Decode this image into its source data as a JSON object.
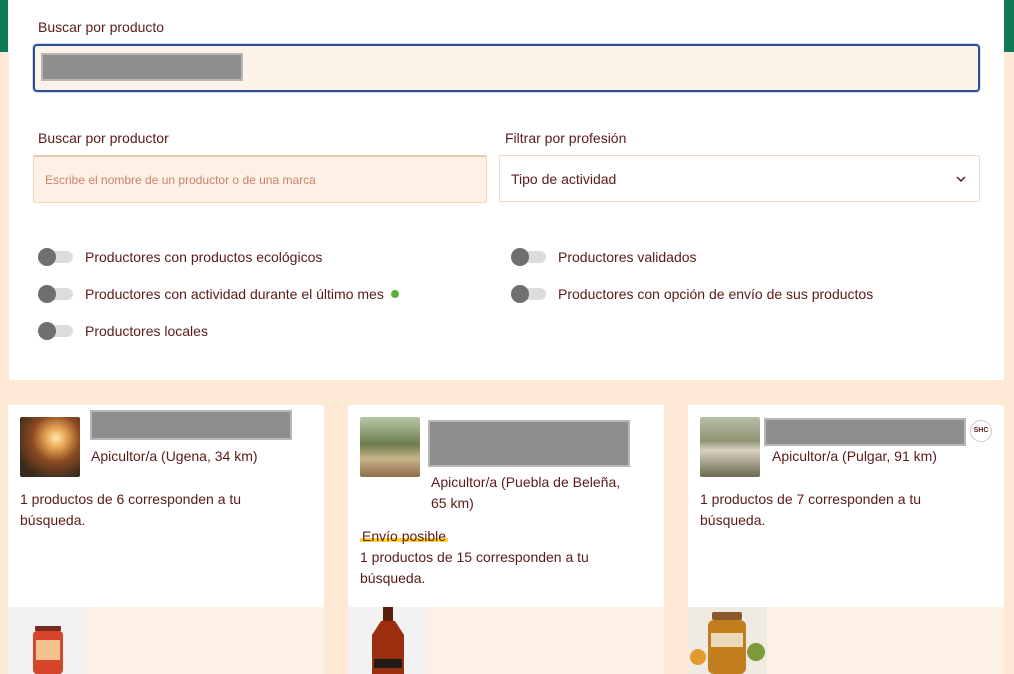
{
  "search": {
    "product_label": "Buscar por producto",
    "product_value": "",
    "producer_label": "Buscar por productor",
    "producer_placeholder": "Escribe el nombre de un productor o de una marca",
    "profession_label": "Filtrar por profesión",
    "profession_selected": "Tipo de actividad"
  },
  "toggles": {
    "eco": "Productores con productos ecológicos",
    "active": "Productores con actividad durante el último mes",
    "local": "Productores locales",
    "validated": "Productores validados",
    "shipping": "Productores con opción de envío de sus productos"
  },
  "cards": [
    {
      "subtitle": "Apicultor/a (Ugena, 34 km)",
      "result": "1 productos de 6 corresponden a tu búsqueda."
    },
    {
      "subtitle": "Apicultor/a (Puebla de Beleña, 65 km)",
      "shipping": "Envío posible",
      "result": "1 productos de 15 corresponden a tu búsqueda."
    },
    {
      "subtitle": "Apicultor/a (Pulgar, 91 km)",
      "badge": "SHC",
      "result": "1 productos de 7 corresponden a tu búsqueda."
    }
  ],
  "colors": {
    "accent_green": "#0f7a57",
    "text": "#5a1a1a",
    "background": "#fde9d6",
    "highlight": "#ffd22e"
  },
  "icons": {
    "select": "chevron-down-icon",
    "activity": "green-dot-icon"
  }
}
